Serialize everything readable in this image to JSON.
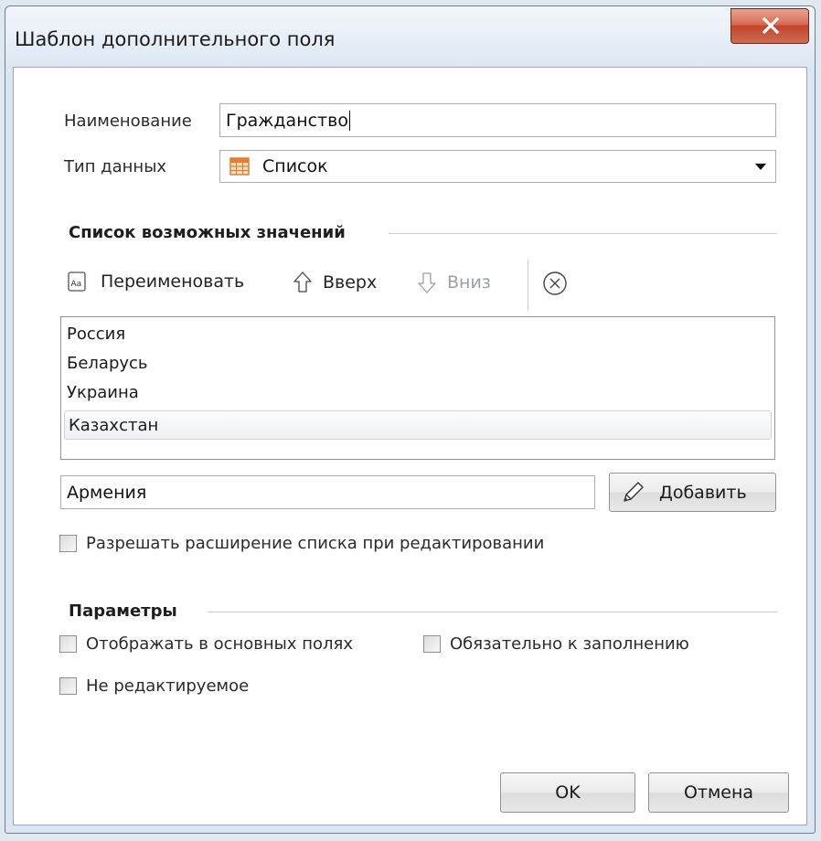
{
  "window": {
    "title": "Шаблон дополнительного поля",
    "close_icon": "close-x-icon"
  },
  "fields": {
    "name_label": "Наименование",
    "name_value": "Гражданство",
    "type_label": "Тип данных",
    "type_value": "Список",
    "type_icon": "grid-list-icon"
  },
  "values_section": {
    "title": "Список возможных значений",
    "toolbar": {
      "rename": "Переименовать",
      "up": "Вверх",
      "down": "Вниз"
    },
    "items": [
      "Россия",
      "Беларусь",
      "Украина",
      "Казахстан"
    ],
    "selected_index": 3,
    "new_value": "Армения",
    "add_label": "Добавить"
  },
  "allow_extend": {
    "label": "Разрешать расширение списка при редактировании",
    "checked": false
  },
  "params": {
    "title": "Параметры",
    "show_in_main": {
      "label": "Отображать в основных полях",
      "checked": false
    },
    "required": {
      "label": "Обязательно к заполнению",
      "checked": false
    },
    "readonly": {
      "label": "Не редактируемое",
      "checked": false
    }
  },
  "buttons": {
    "ok": "OK",
    "cancel": "Отмена"
  },
  "colors": {
    "close_button": "#c2452d",
    "accent_orange": "#e87d2e"
  }
}
